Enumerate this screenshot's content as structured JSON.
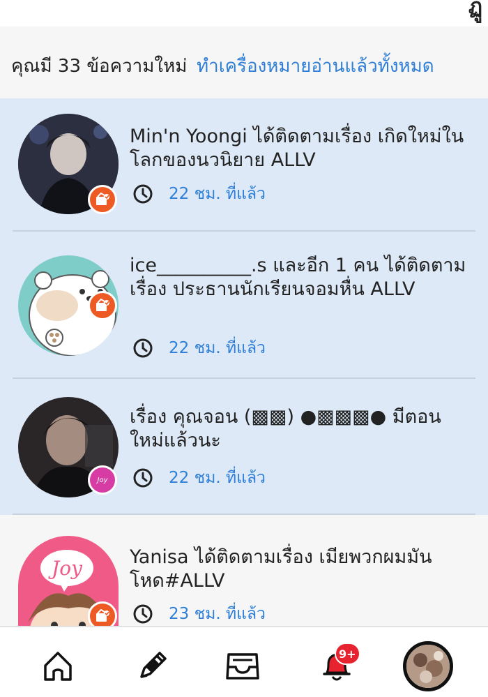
{
  "top": {
    "corner_glyph": "ฏู"
  },
  "summary": {
    "new_messages_text": "คุณมี 33 ข้อความใหม่",
    "mark_all_read_link": "ทำเครื่องหมายอ่านแล้วทั้งหมด"
  },
  "notifications": [
    {
      "text": "Min'n  Yoongi ได้ติดตามเรื่อง เกิดใหม่ในโลกของนวนิยาย ALLV",
      "time": "22 ชม. ที่แล้ว",
      "badge": "follow-icon",
      "unread": true
    },
    {
      "text": "ice__________.s และอีก 1 คน ได้ติดตามเรื่อง ประธานนักเรียนจอมหื่น ALLV",
      "time": "22 ชม. ที่แล้ว",
      "badge": "follow-icon",
      "unread": true
    },
    {
      "text": "เรื่อง คุณจอน (▩▩) ●▩▩▩● มีตอนใหม่แล้วนะ",
      "time": "22 ชม. ที่แล้ว",
      "badge": "joy-icon",
      "badge_text": "Joy",
      "unread": true
    },
    {
      "text": "Yanisa ได้ติดตามเรื่อง เมียพวกผมมันโหด#ALLV",
      "time": "23 ชม. ที่แล้ว",
      "badge": "follow-icon",
      "avatar_text": "Joy",
      "unread": false
    }
  ],
  "bottom_nav": {
    "items": [
      "home-icon",
      "write-icon",
      "inbox-icon",
      "notification-bell-icon",
      "profile-avatar"
    ],
    "notification_count": "9+"
  },
  "colors": {
    "unread_bg": "#dde9f7",
    "read_bg": "#f6f6f6",
    "link": "#2f7fd6",
    "follow_badge": "#ee5a24",
    "joy_badge": "#d63ca3",
    "notif_badge": "#e6232e"
  }
}
